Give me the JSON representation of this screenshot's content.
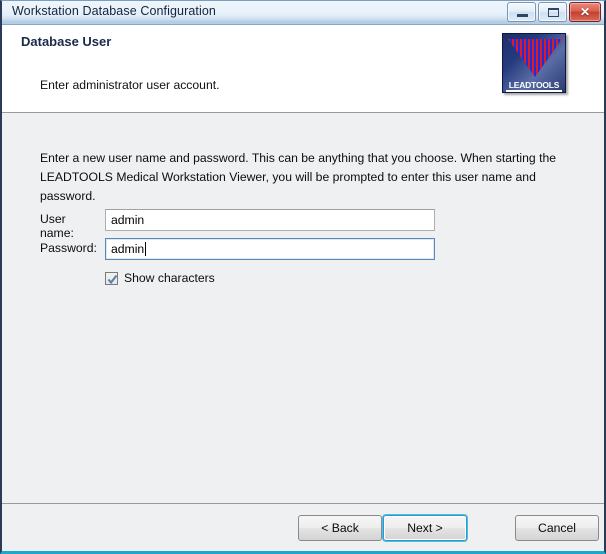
{
  "window": {
    "title": "Workstation Database Configuration",
    "controls": {
      "minimize_label": "minimize-icon",
      "maximize_label": "maximize-icon",
      "close_label": "✕"
    },
    "accent_border_color": "#1aa7d0",
    "frame_border_color": "#2b3a57"
  },
  "header": {
    "title": "Database User",
    "subtitle": "Enter administrator user account.",
    "logo": {
      "text": "LEADTOOLS",
      "stripe_red": "#e01b1b",
      "stripe_blue": "#1b2fe0",
      "background": "#243a7d"
    }
  },
  "main": {
    "intro": "Enter a new user name and password.  This can be anything that you choose. When starting the LEADTOOLS Medical Workstation Viewer, you will be prompted to enter this user name and password.",
    "fields": [
      {
        "label": "User name:",
        "value": "admin",
        "placeholder": "",
        "focused": false
      },
      {
        "label": "Password:",
        "value": "admin",
        "placeholder": "",
        "focused": true
      }
    ],
    "checkbox": {
      "label": "Show characters",
      "checked": true
    }
  },
  "footer": {
    "back_label": "< Back",
    "next_label": "Next >",
    "cancel_label": "Cancel",
    "default_button": "Next >"
  }
}
